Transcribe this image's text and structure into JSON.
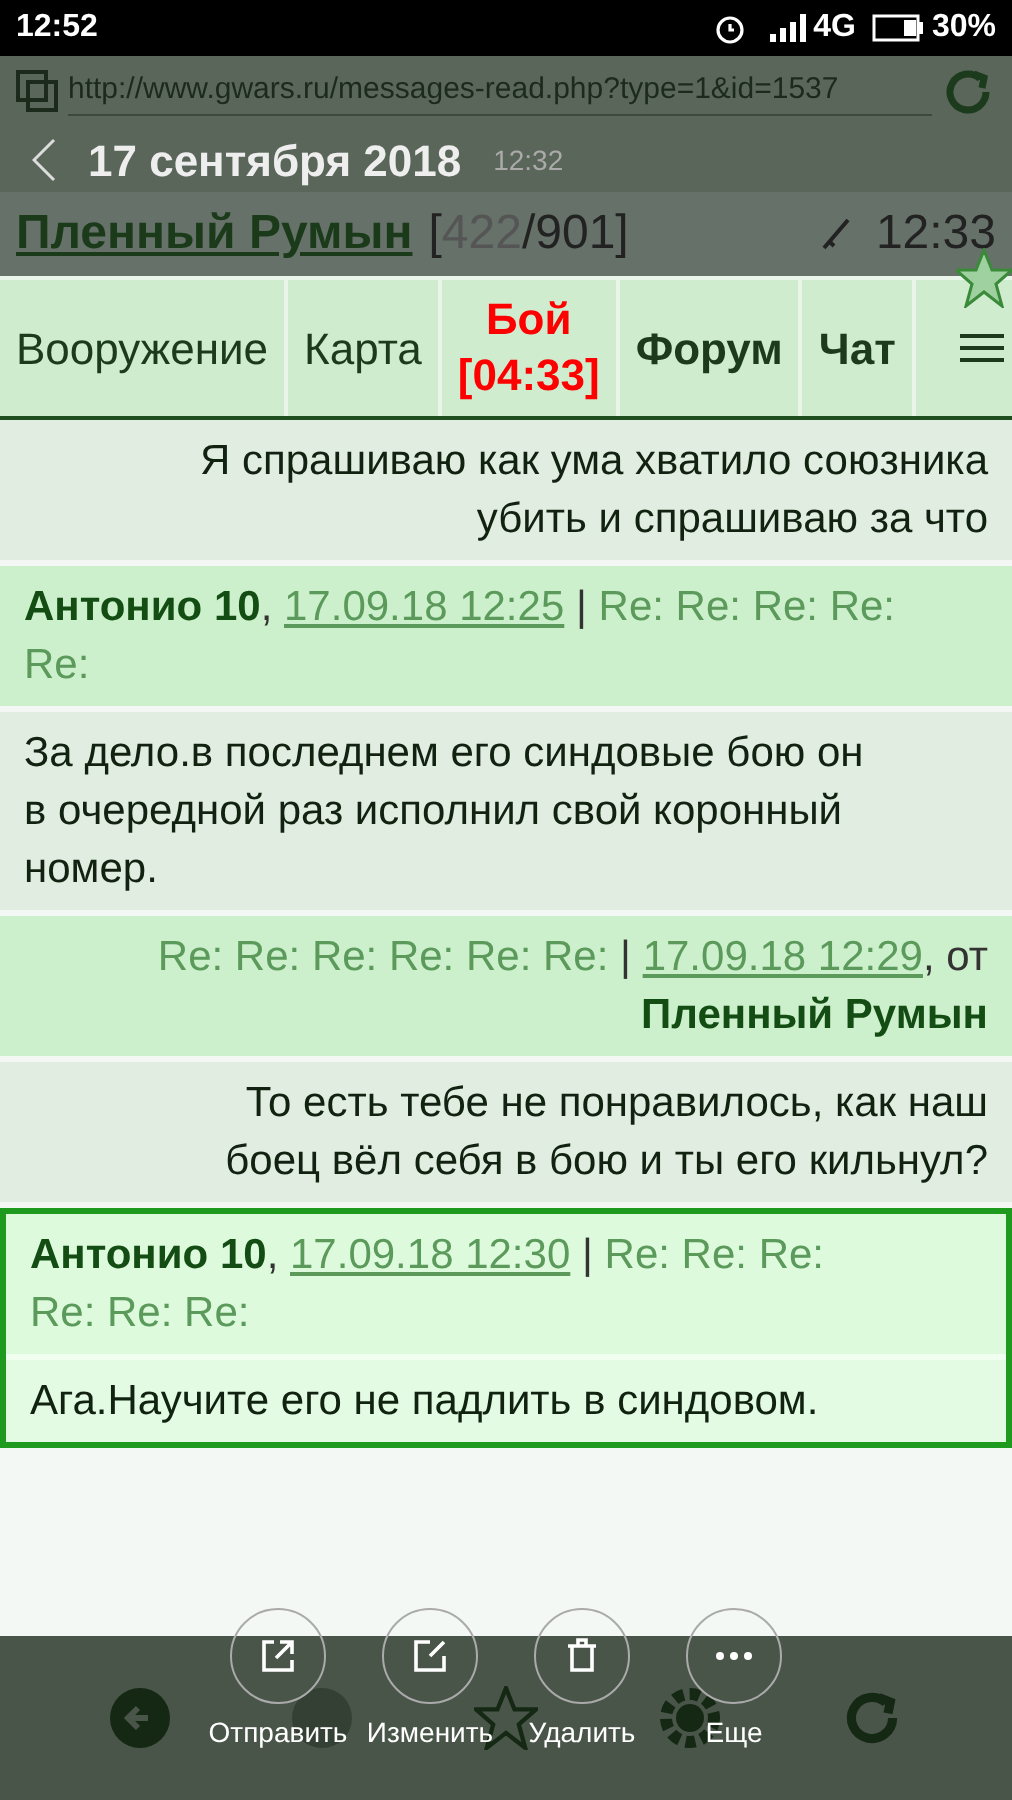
{
  "status_bar": {
    "time": "12:52",
    "network": "4G",
    "battery": "30%"
  },
  "browser": {
    "url": "http://www.gwars.ru/messages-read.php?type=1&id=1537"
  },
  "selection_overlay": {
    "date": "17 сентября 2018",
    "time": "12:32"
  },
  "user": {
    "name": "Пленный Румын",
    "count": "422",
    "total": "/901]",
    "open": "[",
    "time": "12:33"
  },
  "tabs": [
    {
      "label": "Вооружение",
      "kind": "plain"
    },
    {
      "label": "Карта",
      "kind": "plain"
    },
    {
      "label": "Бой",
      "timer": "[04:33]",
      "kind": "alert"
    },
    {
      "label": "Форум",
      "kind": "bold"
    },
    {
      "label": "Чат",
      "kind": "bold"
    }
  ],
  "messages": [
    {
      "kind": "outgoing",
      "selected": false,
      "body": "Я спрашиваю как ума хватило союзника убить и спрашиваю за что"
    },
    {
      "kind": "incoming",
      "selected": false,
      "header": {
        "author": "Антонио 10",
        "comma": ",",
        "date": "17.09.18 12:25",
        "separator": "|",
        "subject": "Re: Re: Re: Re:",
        "subject_continued": "Re:"
      },
      "body": "За дело.в последнем его синдовые бою он в очередной раз исполнил свой коронный номер."
    },
    {
      "kind": "outgoing",
      "selected": false,
      "header": {
        "subject": "Re: Re: Re: Re: Re: Re:",
        "separator": "|",
        "date": "17.09.18 12:29",
        "comma": ",",
        "from": "от",
        "author": "Пленный Румын"
      },
      "body": "То есть тебе не понравилось, как наш боец вёл себя в бою и ты его кильнул?"
    },
    {
      "kind": "incoming",
      "selected": true,
      "header": {
        "author": "Антонио 10",
        "comma": ",",
        "date": "17.09.18 12:30",
        "separator": "|",
        "subject": "Re: Re: Re:",
        "subject_continued": "Re: Re: Re:"
      },
      "body": "Ага.Научите его не падлить в синдовом."
    }
  ],
  "actions": [
    {
      "label": "Отправить"
    },
    {
      "label": "Изменить"
    },
    {
      "label": "Удалить"
    },
    {
      "label": "Еще"
    }
  ]
}
